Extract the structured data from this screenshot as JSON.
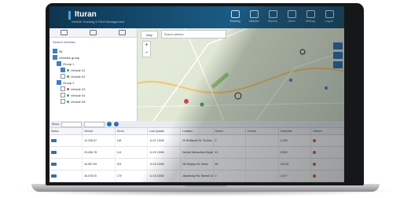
{
  "app": {
    "brand": "Ituran",
    "tagline": "Vehicle Tracking & Fleet Management"
  },
  "topbar": {
    "items": [
      {
        "label": "Tracking",
        "icon": "tracking-icon"
      },
      {
        "label": "Vehicles",
        "icon": "car-icon"
      },
      {
        "label": "Reports",
        "icon": "report-icon"
      },
      {
        "label": "Alerts",
        "icon": "alert-icon"
      },
      {
        "label": "Settings",
        "icon": "gear-icon"
      },
      {
        "label": "Logout",
        "icon": "logout-icon"
      }
    ]
  },
  "sidebar": {
    "search_label": "Search Vehicles",
    "rows": [
      {
        "label": "All",
        "checked": true,
        "status": "none"
      },
      {
        "label": "Vehicles group",
        "checked": true,
        "status": "none"
      },
      {
        "label": "Group 1",
        "checked": true,
        "status": "none"
      },
      {
        "label": "Vehicle 01",
        "checked": true,
        "status": "green"
      },
      {
        "label": "Vehicle 02",
        "checked": false,
        "status": "green"
      },
      {
        "label": "Group 2",
        "checked": true,
        "status": "none"
      },
      {
        "label": "Vehicle 03",
        "checked": false,
        "status": "red"
      },
      {
        "label": "Vehicle 04",
        "checked": false,
        "status": "green"
      },
      {
        "label": "Vehicle 05",
        "checked": false,
        "status": "green"
      }
    ]
  },
  "map": {
    "type_label": "Map",
    "search_placeholder": "Search address",
    "zoom_in": "+",
    "zoom_out": "−"
  },
  "grid": {
    "filter_label": "Show",
    "columns": [
      "Status",
      "Vehicle",
      "Driver",
      "Last Update",
      "Location",
      "Speed",
      "Events",
      "Odometer",
      "Actions"
    ],
    "rows": [
      [
        "",
        "12-345-67",
        "118",
        "11:21 15/08",
        "20 Ha'Barzel St, Tel Aviv",
        "0",
        "",
        "1,245",
        ""
      ],
      [
        "",
        "23-456-78",
        "114",
        "11:20 15/08",
        "Derech Menachem Begin, Tel Aviv",
        "42",
        "",
        "8,930",
        ""
      ],
      [
        "",
        "34-567-89",
        "201",
        "11:18 15/08",
        "Ha'Ta'asiya St, Holon",
        "65",
        "",
        "23,114",
        ""
      ],
      [
        "",
        "45-678-90",
        "175",
        "11:15 15/08",
        "Jabotinsky Rd, Ramat Gan",
        "0",
        "",
        "4,077",
        ""
      ]
    ]
  },
  "colors": {
    "topbar": "#164e73",
    "accent": "#2f6fae",
    "online": "#3aa35a",
    "offline": "#d64545"
  }
}
